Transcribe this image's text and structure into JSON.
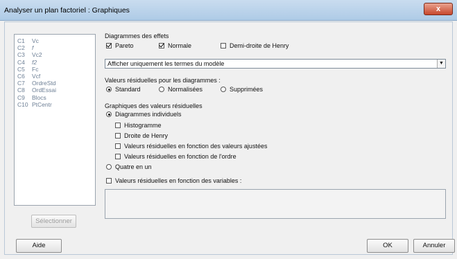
{
  "window": {
    "title": "Analyser un plan factoriel : Graphiques",
    "close_label": "x"
  },
  "variables": [
    {
      "num": "C1",
      "name": "Vc"
    },
    {
      "num": "C2",
      "name": "f"
    },
    {
      "num": "C3",
      "name": "Vc2"
    },
    {
      "num": "C4",
      "name": "f2"
    },
    {
      "num": "C5",
      "name": "Fc"
    },
    {
      "num": "C6",
      "name": "Vcf"
    },
    {
      "num": "C7",
      "name": "OrdreStd"
    },
    {
      "num": "C8",
      "name": "OrdEssai"
    },
    {
      "num": "C9",
      "name": "Blocs"
    },
    {
      "num": "C10",
      "name": "PtCentr"
    }
  ],
  "effects": {
    "heading": "Diagrammes des effets",
    "pareto": {
      "label": "Pareto",
      "checked": true
    },
    "normale": {
      "label": "Normale",
      "checked": true
    },
    "demi_droite": {
      "label": "Demi-droite de Henry",
      "checked": false
    },
    "terms_select": "Afficher uniquement les termes du modèle"
  },
  "residuals_type": {
    "heading": "Valeurs résiduelles pour les diagrammes :",
    "options": [
      {
        "label": "Standard",
        "checked": true
      },
      {
        "label": "Normalisées",
        "checked": false
      },
      {
        "label": "Supprimées",
        "checked": false
      }
    ]
  },
  "residual_plots": {
    "heading": "Graphiques des valeurs résiduelles",
    "individual": {
      "label": "Diagrammes individuels",
      "checked": true
    },
    "items": [
      {
        "label": "Histogramme",
        "checked": false
      },
      {
        "label": "Droite de Henry",
        "checked": false
      },
      {
        "label": "Valeurs résiduelles en fonction des valeurs ajustées",
        "checked": false
      },
      {
        "label": "Valeurs résiduelles en fonction de l'ordre",
        "checked": false
      }
    ],
    "four_in_one": {
      "label": "Quatre en un",
      "checked": false
    },
    "vs_variables": {
      "label": "Valeurs résiduelles en fonction des variables :",
      "checked": false
    }
  },
  "buttons": {
    "select": "Sélectionner",
    "help": "Aide",
    "ok": "OK",
    "cancel": "Annuler"
  }
}
